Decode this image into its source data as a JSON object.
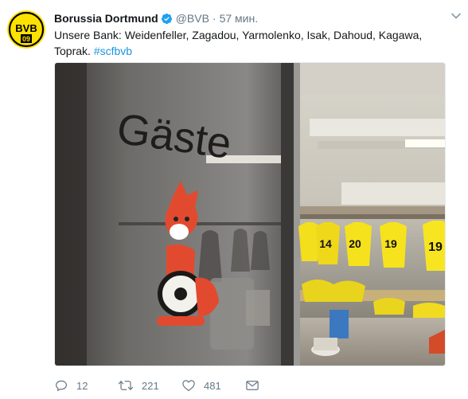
{
  "tweet": {
    "author": {
      "display_name": "Borussia Dortmund",
      "handle": "@BVB",
      "verified": true
    },
    "separator": "·",
    "time": "57 мин.",
    "text_plain": "Unsere Bank: Weidenfeller, Zagadou, Yarmolenko, Isak, Dahoud, Kagawa, Toprak. ",
    "hashtag": "#scfbvb",
    "photo_text": {
      "sign": "Gäste",
      "jersey_numbers": [
        "14",
        "20",
        "19",
        "19"
      ]
    },
    "actions": {
      "replies": "12",
      "retweets": "221",
      "likes": "481"
    }
  },
  "avatar_logo": {
    "letters": "BVB",
    "year": "09"
  },
  "colors": {
    "bvb_yellow": "#fde100",
    "bvb_black": "#000000",
    "link": "#1b95e0",
    "muted": "#657786",
    "verified": "#1da1f2"
  },
  "icons": [
    "bvb-logo-icon",
    "verified-badge-icon",
    "chevron-down-icon",
    "reply-icon",
    "retweet-icon",
    "like-icon",
    "direct-message-icon"
  ]
}
